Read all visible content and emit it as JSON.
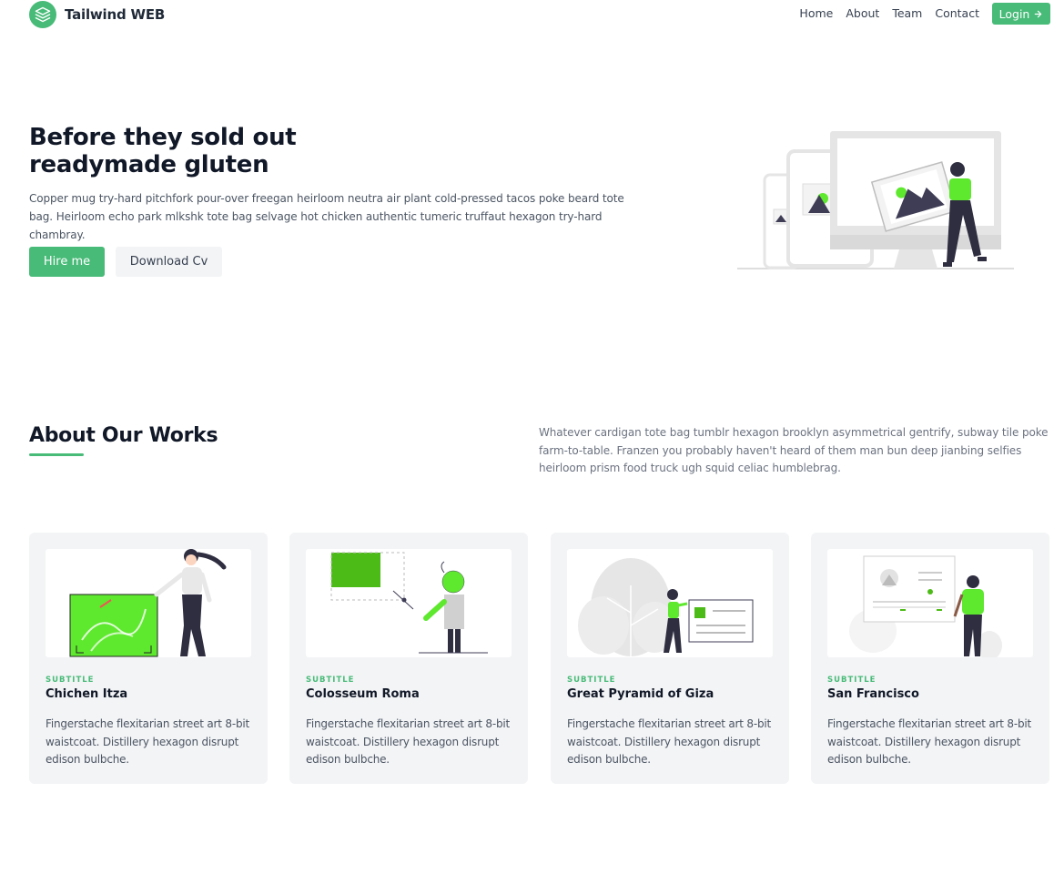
{
  "header": {
    "brand": "Tailwind WEB",
    "nav": [
      "Home",
      "About",
      "Team",
      "Contact"
    ],
    "login": "Login"
  },
  "hero": {
    "title_line1": "Before they sold out",
    "title_line2": "readymade gluten",
    "text": "Copper mug try-hard pitchfork pour-over freegan heirloom neutra air plant cold-pressed tacos poke beard tote bag. Heirloom echo park mlkshk tote bag selvage hot chicken authentic tumeric truffaut hexagon try-hard chambray.",
    "primary_button": "Hire me",
    "secondary_button": "Download Cv"
  },
  "about": {
    "title": "About Our Works",
    "text": "Whatever cardigan tote bag tumblr hexagon brooklyn asymmetrical gentrify, subway tile poke farm-to-table. Franzen you probably haven't heard of them man bun deep jianbing selfies heirloom prism food truck ugh squid celiac humblebrag."
  },
  "cards": [
    {
      "subtitle": "SUBTITLE",
      "title": "Chichen Itza",
      "text": "Fingerstache flexitarian street art 8-bit waistcoat. Distillery hexagon disrupt edison bulbche."
    },
    {
      "subtitle": "SUBTITLE",
      "title": "Colosseum Roma",
      "text": "Fingerstache flexitarian street art 8-bit waistcoat. Distillery hexagon disrupt edison bulbche."
    },
    {
      "subtitle": "SUBTITLE",
      "title": "Great Pyramid of Giza",
      "text": "Fingerstache flexitarian street art 8-bit waistcoat. Distillery hexagon disrupt edison bulbche."
    },
    {
      "subtitle": "SUBTITLE",
      "title": "San Francisco",
      "text": "Fingerstache flexitarian street art 8-bit waistcoat. Distillery hexagon disrupt edison bulbche."
    }
  ],
  "icons": {
    "brand": "layers-icon",
    "login_arrow": "arrow-right-icon"
  },
  "colors": {
    "accent": "#48bb78",
    "illustration_green": "#5ee82e",
    "card_bg": "#f3f4f6"
  }
}
